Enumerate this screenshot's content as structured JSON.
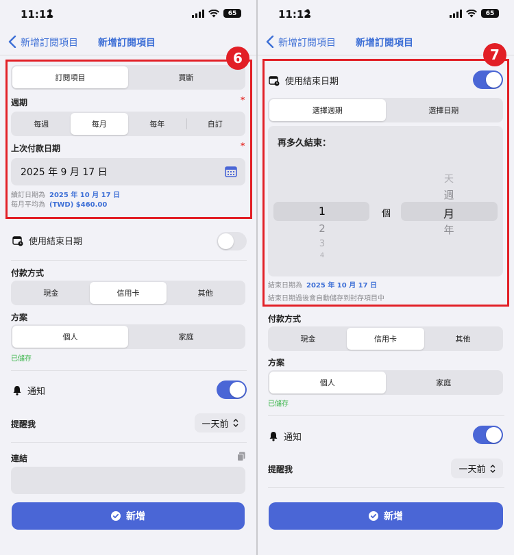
{
  "status_left": {
    "time": "11:11",
    "battery": "65"
  },
  "status_right": {
    "time": "11:12",
    "battery": "65"
  },
  "nav": {
    "back": "新增訂閱項目",
    "title": "新增訂閱項目"
  },
  "left": {
    "badge": "6",
    "type_tabs": [
      "訂閱項目",
      "買斷"
    ],
    "period_label": "週期",
    "period_options": [
      "每週",
      "每月",
      "每年",
      "自訂"
    ],
    "last_payment_label": "上次付款日期",
    "last_payment_value": "2025 年 9 月 17 日",
    "renew_label": "續訂日期為",
    "renew_value": "2025 年 10 月 17 日",
    "avg_label": "每月平均為",
    "avg_value": "(TWD) $460.00",
    "end_date_label": "使用結束日期",
    "payment_label": "付款方式",
    "payment_options": [
      "現金",
      "信用卡",
      "其他"
    ],
    "plan_label": "方案",
    "plan_options": [
      "個人",
      "家庭"
    ],
    "saved": "已儲存",
    "notify_label": "通知",
    "remind_label": "提醒我",
    "remind_value": "一天前",
    "link_label": "連結",
    "add_button": "新增"
  },
  "right": {
    "badge": "7",
    "end_date_label": "使用結束日期",
    "end_tabs": [
      "選擇週期",
      "選擇日期"
    ],
    "picker_title": "再多久結束：",
    "picker_numbers": [
      "1",
      "2",
      "3",
      "4"
    ],
    "picker_unit": "個",
    "picker_units": [
      "天",
      "週",
      "月",
      "年"
    ],
    "end_info_label": "結束日期為",
    "end_info_value": "2025 年 10 月 17 日",
    "end_note": "結束日期過後會自動儲存到封存項目中",
    "payment_label": "付款方式",
    "payment_options": [
      "現金",
      "信用卡",
      "其他"
    ],
    "plan_label": "方案",
    "plan_options": [
      "個人",
      "家庭"
    ],
    "saved": "已儲存",
    "notify_label": "通知",
    "remind_label": "提醒我",
    "remind_value": "一天前",
    "add_button": "新增"
  },
  "colors": {
    "accent": "#4a66d6",
    "highlight": "#e21f26",
    "saved_green": "#3ab54a"
  }
}
